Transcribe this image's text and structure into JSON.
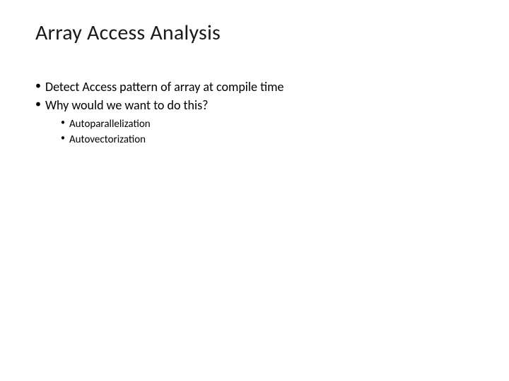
{
  "slide": {
    "title": "Array Access Analysis",
    "bullets": [
      {
        "text": "Detect Access pattern of array at compile time"
      },
      {
        "text": "Why would we want to do this?",
        "children": [
          {
            "text": "Autoparallelization"
          },
          {
            "text": "Autovectorization"
          }
        ]
      }
    ]
  }
}
